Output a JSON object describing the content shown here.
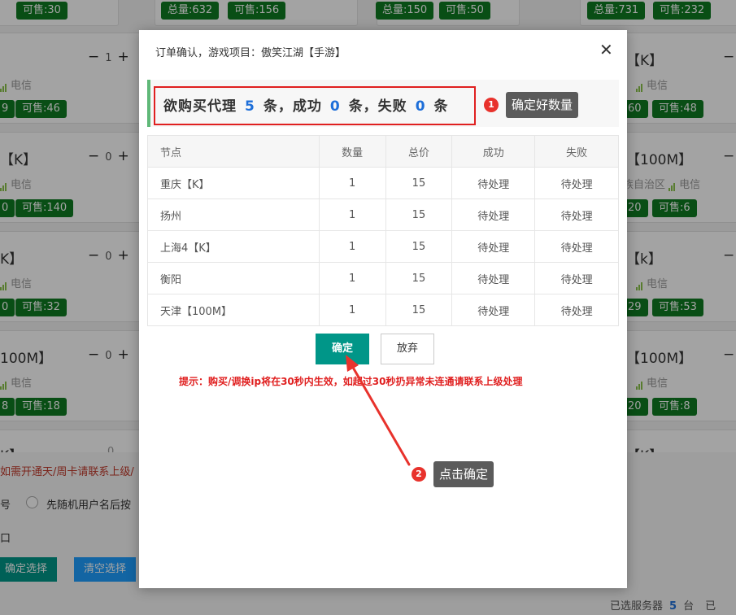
{
  "background": {
    "top_badges": [
      "可售:30",
      "总量:632",
      "可售:156",
      "总量:150",
      "可售:50",
      "总量:731",
      "可售:232"
    ],
    "rows": [
      {
        "left_title": "",
        "left_stepper": "1",
        "right_title": "【K】",
        "left_badges": [
          "9",
          "可售:46"
        ],
        "right_badges": [
          "60",
          "可售:48"
        ]
      },
      {
        "left_title": "【K】",
        "left_stepper": "0",
        "right_title": "【100M】",
        "left_badges": [
          "0",
          "可售:140"
        ],
        "right_badges": [
          "20",
          "可售:6"
        ]
      },
      {
        "left_title": "K】",
        "left_stepper": "0",
        "right_title": "【k】",
        "left_badges": [
          "0",
          "可售:32"
        ],
        "right_badges": [
          "29",
          "可售:53"
        ]
      },
      {
        "left_title": "100M】",
        "left_stepper": "0",
        "right_title": "【100M】",
        "left_badges": [
          "8",
          "可售:18"
        ],
        "right_badges": [
          "20",
          "可售:8"
        ]
      }
    ],
    "isp_label": "电信",
    "right_region_partial": "族自治区",
    "stepper_minus": "−",
    "stepper_plus": "+",
    "partial_title_left": "K】",
    "partial_title_right": "【K】",
    "partial_stepper": "0",
    "notice": "如需开通天/周卡请联系上级/",
    "radio_prefix": "号",
    "radio_option": "先随机用户名后按",
    "field_prefix": "口",
    "confirm_select": "确定选择",
    "clear_select": "清空选择",
    "footer_label": "已选服务器",
    "footer_count": "5",
    "footer_unit": "台",
    "footer_tail": "已"
  },
  "modal": {
    "title": "订单确认，游戏项目：傲笑江湖【手游】",
    "close_glyph": "✕",
    "summary": {
      "prefix": "欲购买代理",
      "total": "5",
      "unit1": "条，成功",
      "success": "0",
      "unit2": "条，失败",
      "failed": "0",
      "unit3": "条"
    },
    "table": {
      "headers": [
        "节点",
        "数量",
        "总价",
        "成功",
        "失败"
      ],
      "rows": [
        [
          "重庆【K】",
          "1",
          "15",
          "待处理",
          "待处理"
        ],
        [
          "扬州",
          "1",
          "15",
          "待处理",
          "待处理"
        ],
        [
          "上海4【K】",
          "1",
          "15",
          "待处理",
          "待处理"
        ],
        [
          "衡阳",
          "1",
          "15",
          "待处理",
          "待处理"
        ],
        [
          "天津【100M】",
          "1",
          "15",
          "待处理",
          "待处理"
        ]
      ]
    },
    "confirm_label": "确定",
    "cancel_label": "放弃",
    "tip": "提示：购买/调换ip将在30秒内生效，如超过30秒扔异常未连通请联系上级处理"
  },
  "annotations": [
    {
      "number": "1",
      "text": "确定好数量"
    },
    {
      "number": "2",
      "text": "点击确定"
    }
  ],
  "colors": {
    "accent": "#009688",
    "badge_green": "#0f7a22",
    "highlight_red": "#e02020",
    "number_blue": "#1e6fd9",
    "marker_red": "#e8322c",
    "callout_gray": "#5b5b5b"
  }
}
